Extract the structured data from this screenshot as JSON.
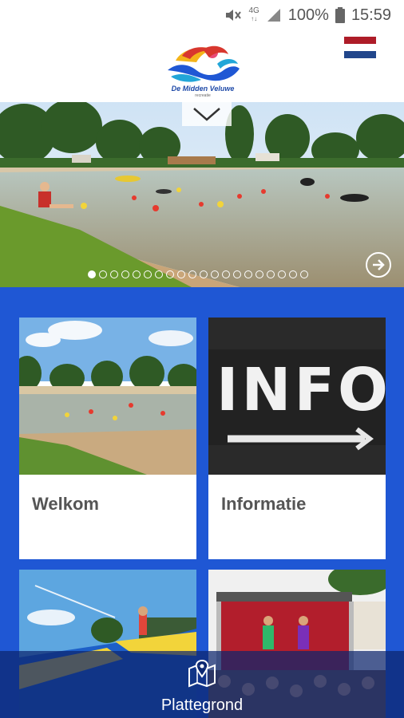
{
  "status_bar": {
    "network": "4G",
    "battery": "100%",
    "time": "15:59"
  },
  "header": {
    "logo_name": "De Midden Veluwe",
    "logo_sub": "recreatie",
    "flag": "nl-flag"
  },
  "hero": {
    "slide_count": 20,
    "active_slide": 1
  },
  "tiles": [
    {
      "label": "Welkom"
    },
    {
      "label": "Informatie"
    },
    {
      "label": ""
    },
    {
      "label": ""
    }
  ],
  "info_sign": {
    "text": "INFO"
  },
  "bottom_nav": {
    "label": "Plattegrond"
  },
  "colors": {
    "grid_bg": "#1f57d4",
    "accent_red": "#d8372e",
    "flag_red": "#ae1c28",
    "flag_blue": "#21468b"
  }
}
